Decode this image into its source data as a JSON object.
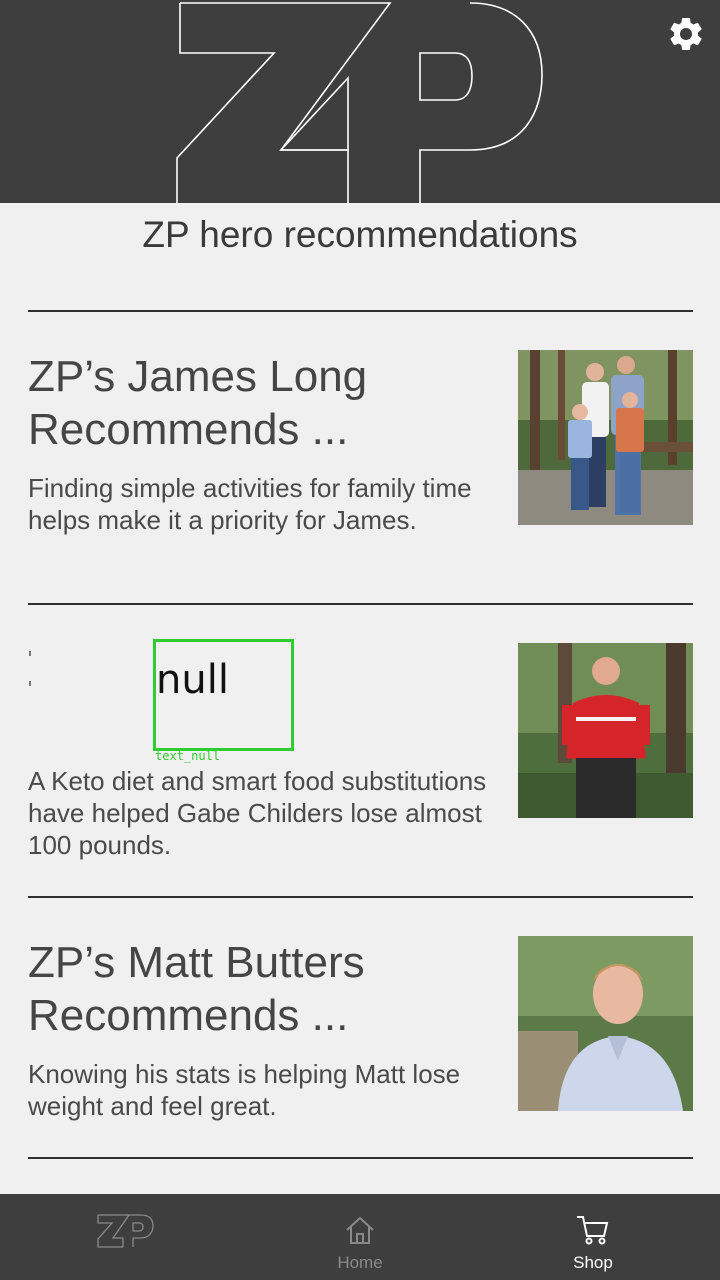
{
  "page": {
    "title": "ZP hero recommendations"
  },
  "header": {
    "logo": "ZP",
    "settings_icon": "gear-icon"
  },
  "cards": [
    {
      "title": "ZP’s James Long Recommends ...",
      "description": "Finding simple activities for family time helps make it a priority for James.",
      "photo": "family-photo"
    },
    {
      "title": "null",
      "title_caption": "text_null",
      "description": "A Keto diet and smart food substitutions have helped Gabe Childers lose almost 100 pounds.",
      "photo": "man-red-shirt-photo"
    },
    {
      "title": "ZP’s Matt Butters Recommends ...",
      "description": "Knowing his stats is helping Matt lose weight and feel great.",
      "photo": "smiling-man-photo"
    }
  ],
  "bottom_nav": {
    "items": [
      {
        "label": "",
        "icon": "zp-logo-icon",
        "active": false
      },
      {
        "label": "Home",
        "icon": "home-icon",
        "active": false
      },
      {
        "label": "Shop",
        "icon": "cart-icon",
        "active": true
      }
    ]
  },
  "colors": {
    "header_bg": "#3e3e3e",
    "page_bg": "#f0f0f0",
    "nav_active": "#ffffff",
    "nav_inactive": "#8a8a8a",
    "highlight_box": "#2ecc2e"
  }
}
